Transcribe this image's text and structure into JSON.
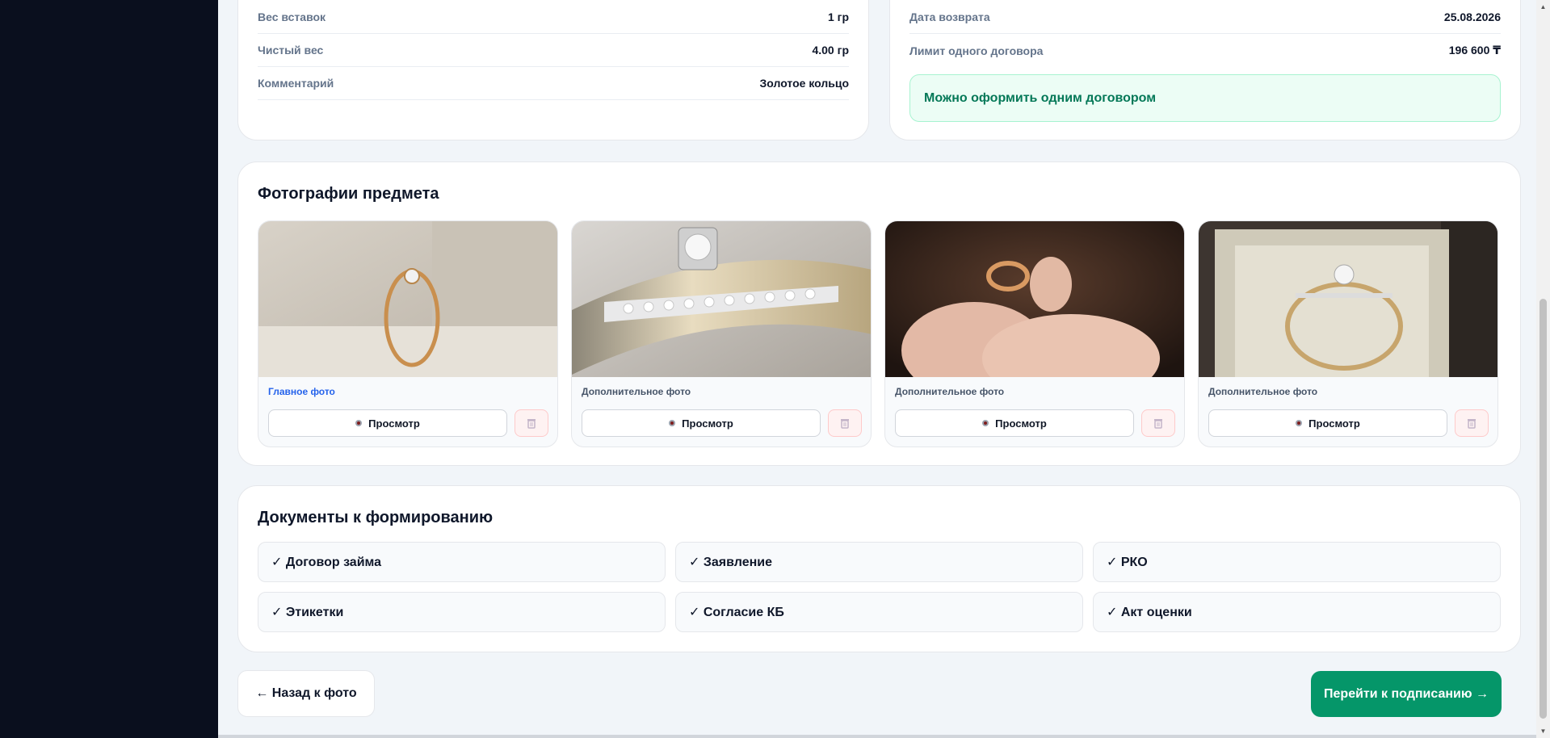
{
  "info_left": {
    "rows": [
      {
        "label": "Вес вставок",
        "value": "1 гр"
      },
      {
        "label": "Чистый вес",
        "value": "4.00 гр"
      },
      {
        "label": "Комментарий",
        "value": "Золотое кольцо"
      }
    ]
  },
  "info_right": {
    "rows": [
      {
        "label": "Дата возврата",
        "value": "25.08.2026"
      },
      {
        "label": "Лимит одного договора",
        "value": "196 600 ₸"
      }
    ],
    "banner": "Можно оформить одним договором"
  },
  "photos": {
    "title": "Фотографии предмета",
    "items": [
      {
        "label": "Главное фото",
        "view_label": "Просмотр"
      },
      {
        "label": "Дополнительное фото",
        "view_label": "Просмотр"
      },
      {
        "label": "Дополнительное фото",
        "view_label": "Просмотр"
      },
      {
        "label": "Дополнительное фото",
        "view_label": "Просмотр"
      }
    ]
  },
  "documents": {
    "title": "Документы к формированию",
    "items": [
      "✓ Договор займа",
      "✓ Заявление",
      "✓ РКО",
      "✓ Этикетки",
      "✓ Согласие КБ",
      "✓ Акт оценки"
    ]
  },
  "actions": {
    "back_label": "← Назад к фото",
    "next_label": "Перейти к подписанию →"
  },
  "colors": {
    "sidebar": "#0a0f1e",
    "accent_green": "#059669",
    "link_blue": "#2563eb"
  }
}
